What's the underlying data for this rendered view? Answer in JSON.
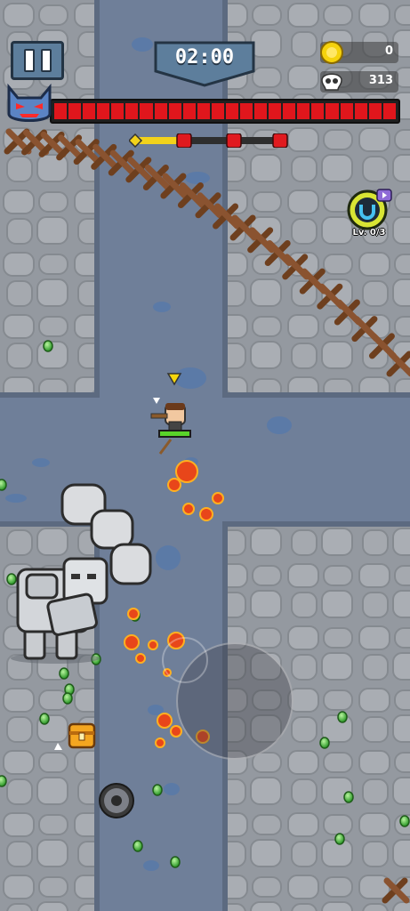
{
  "hud": {
    "timer": "02:00",
    "coins": "0",
    "kills": "313",
    "magnet_level": "Lv. 0/3"
  },
  "boss": {
    "health_fraction": 1.0,
    "segments": 24
  },
  "wave": {
    "progress_fraction": 0.3,
    "markers": 3
  },
  "colors": {
    "ground": "#8f959c",
    "road": "#6f7f99",
    "health_red": "#e0161c",
    "wave_yellow": "#f2d21b",
    "player_hp_green": "#59d42a",
    "gem_green": "#4ec13a"
  },
  "icons": [
    "pause-icon",
    "timer-banner",
    "coin-icon",
    "skull-icon",
    "boss-icon",
    "magnet-icon",
    "video-ad-icon",
    "treasure-chest-icon",
    "sawblade-icon"
  ],
  "player": {
    "hp_fraction": 1.0
  }
}
